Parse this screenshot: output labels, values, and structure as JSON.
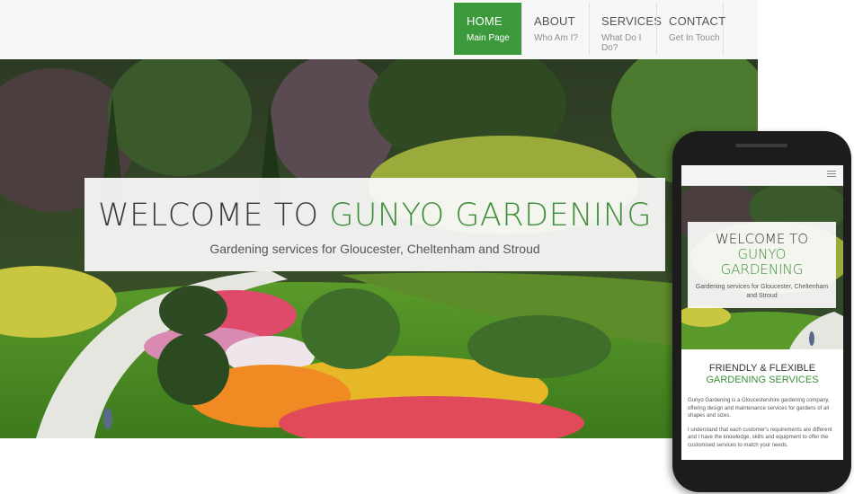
{
  "nav": [
    {
      "title": "HOME",
      "subtitle": "Main Page",
      "active": true
    },
    {
      "title": "ABOUT",
      "subtitle": "Who Am I?",
      "active": false
    },
    {
      "title": "SERVICES",
      "subtitle": "What Do I Do?",
      "active": false
    },
    {
      "title": "CONTACT",
      "subtitle": "Get In Touch",
      "active": false
    }
  ],
  "hero": {
    "welcome_dark": "WELCOME TO ",
    "welcome_green": "GUNYO GARDENING",
    "tagline": "Gardening services for Gloucester, Cheltenham and Stroud",
    "image_icon": "garden-photo"
  },
  "mobile": {
    "menu_icon": "hamburger-menu-icon",
    "welcome_line1": "WELCOME TO",
    "welcome_line2": "GUNYO",
    "welcome_line3": "GARDENING",
    "tagline": "Gardening services for Gloucester, Cheltenham and Stroud",
    "section_heading_dark": "FRIENDLY & FLEXIBLE",
    "section_heading_green": "GARDENING SERVICES",
    "paragraph1": "Gunyo Gardening is a Gloucestershire gardening company, offering design and maintenance services for gardens of all shapes and sizes.",
    "paragraph2": "I understand that each customer's requirements are different and I have the knowledge, skills and equipment to offer the customised services to match your needs."
  },
  "colors": {
    "accent_green": "#3d9a3c",
    "navbar_bg": "#f7f7f7",
    "text_dark": "#3a3a3a"
  }
}
